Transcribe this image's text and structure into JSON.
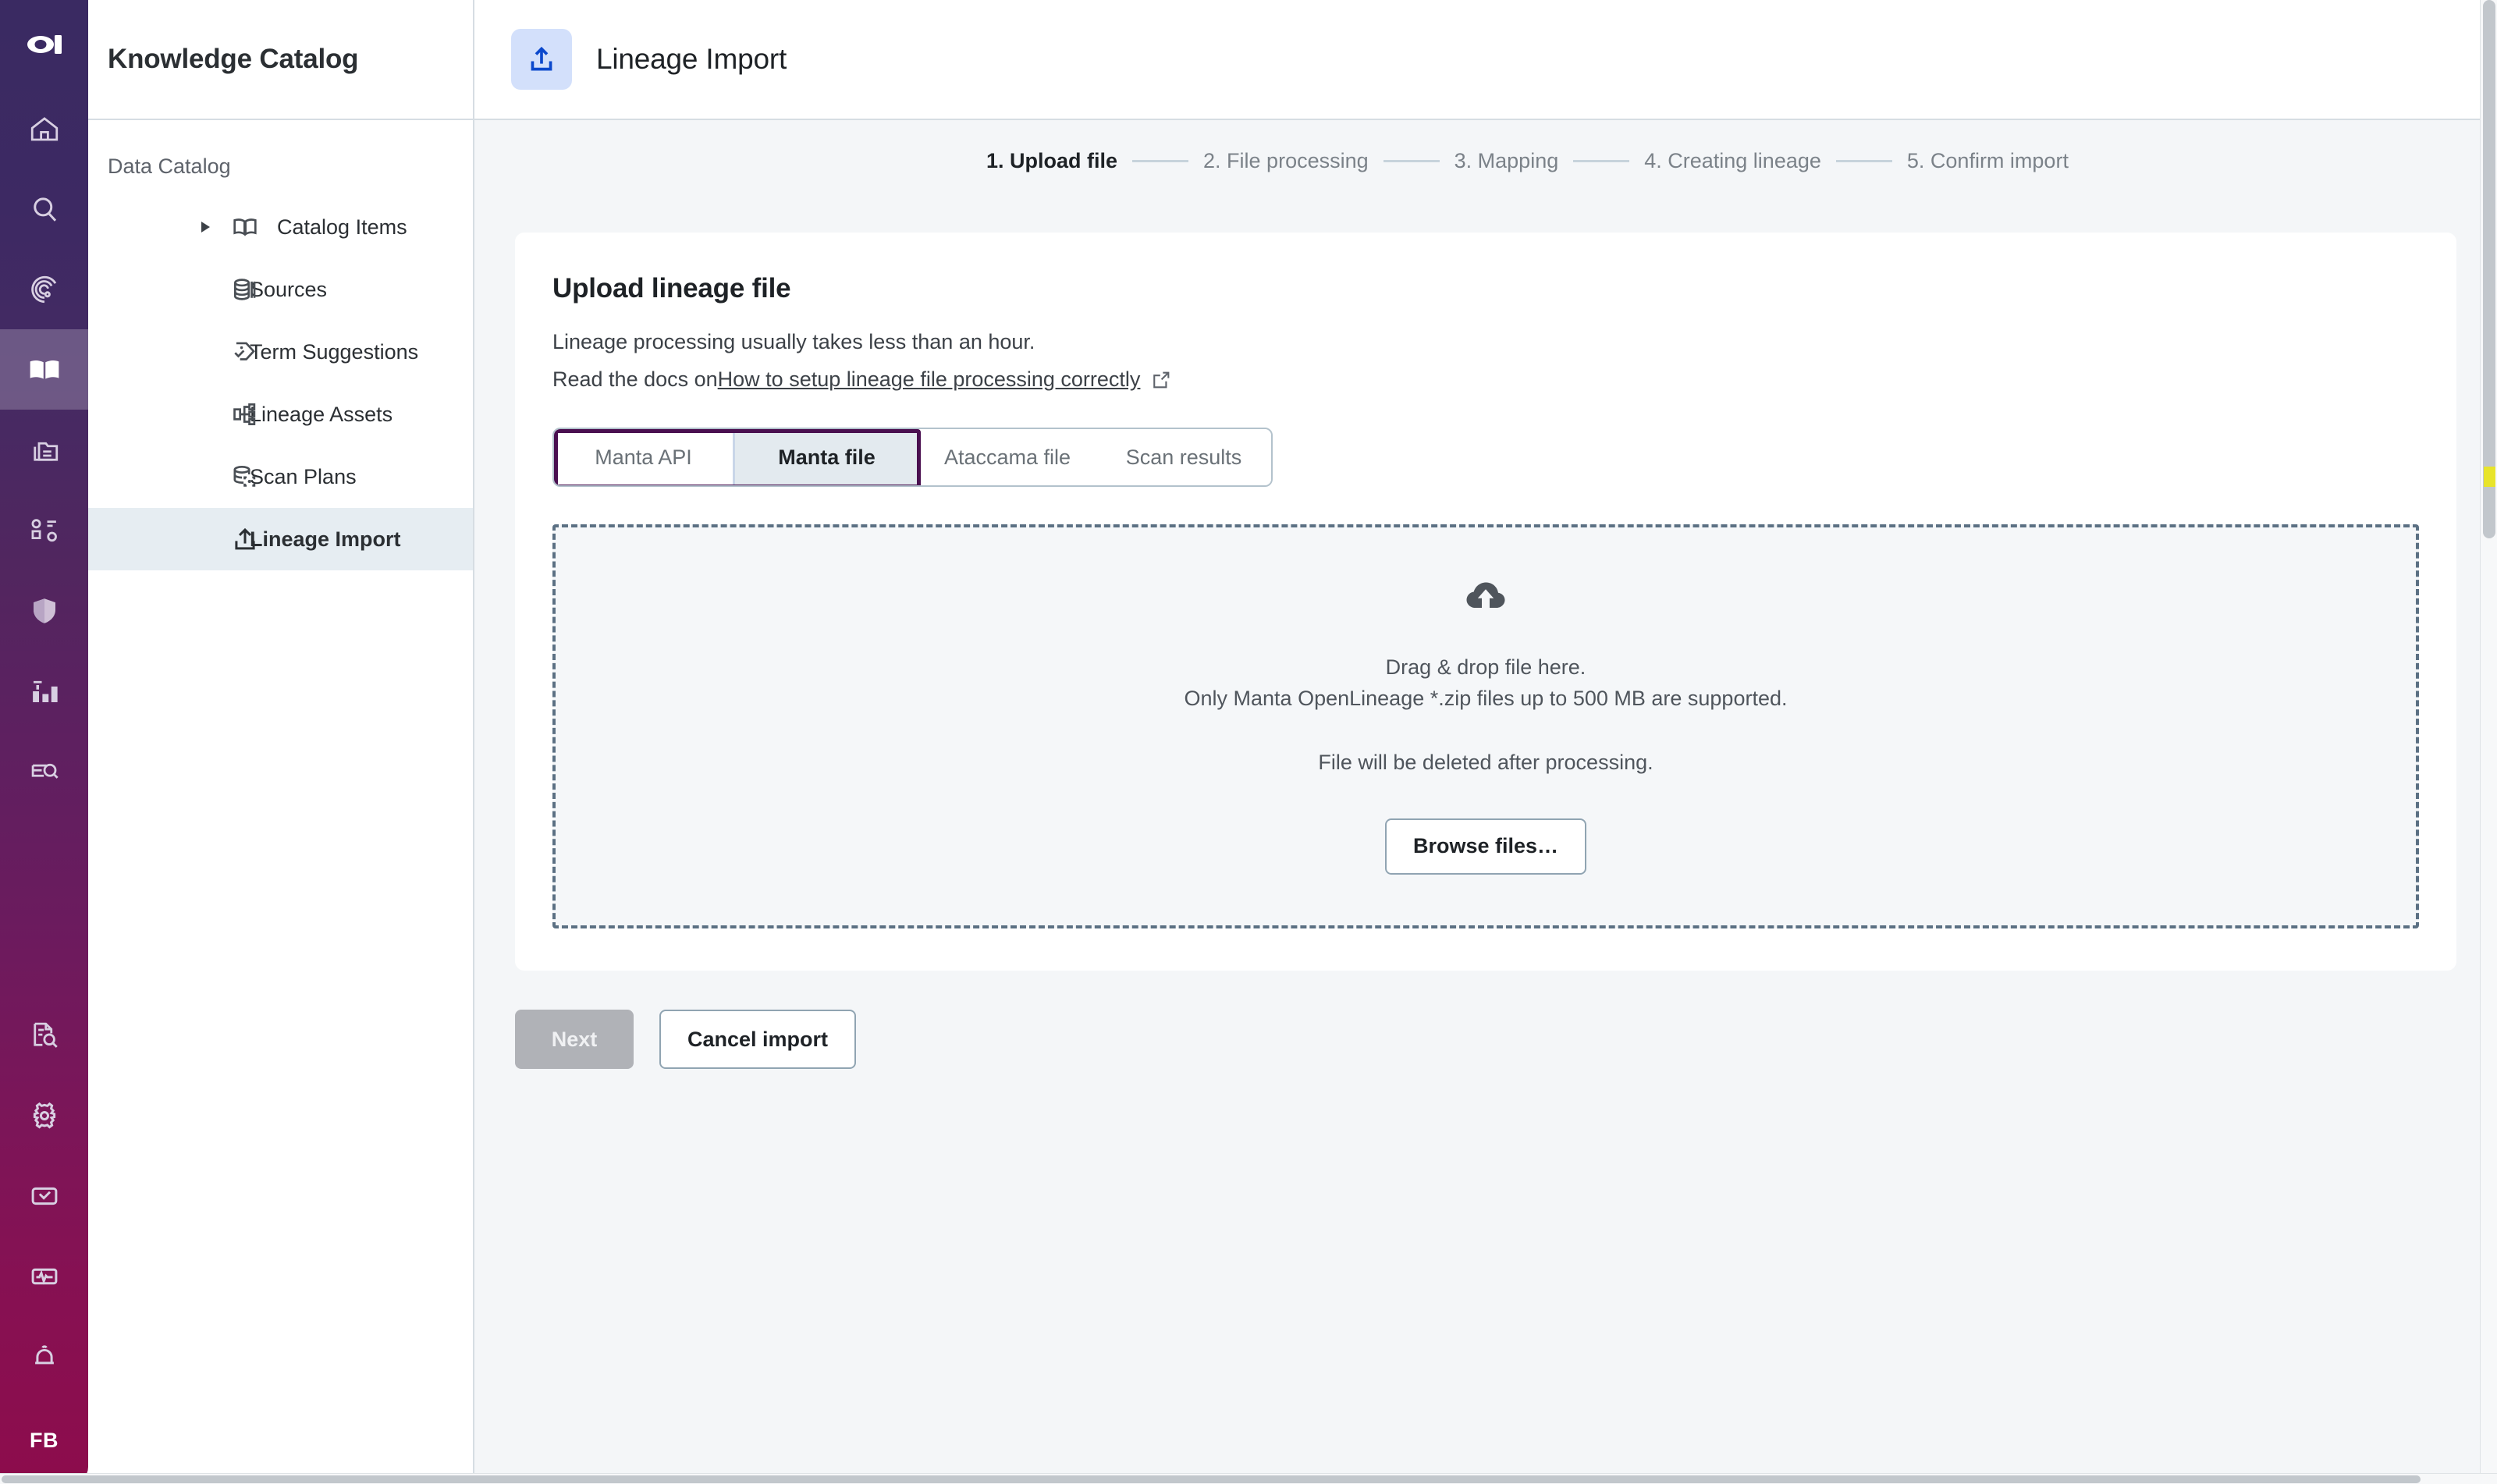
{
  "rail": {
    "logo_icon": "ataccama-logo-icon",
    "items": [
      {
        "icon": "home-icon",
        "name": "home",
        "active": false
      },
      {
        "icon": "search-icon",
        "name": "search",
        "active": false
      },
      {
        "icon": "radar-icon",
        "name": "data-observability",
        "active": false
      },
      {
        "icon": "book-icon",
        "name": "knowledge-catalog",
        "active": true
      },
      {
        "icon": "folders-icon",
        "name": "data-sources",
        "active": false
      },
      {
        "icon": "model-icon",
        "name": "data-model",
        "active": false
      },
      {
        "icon": "shield-icon",
        "name": "data-governance",
        "active": false
      },
      {
        "icon": "bar-chart-icon",
        "name": "data-quality",
        "active": false
      },
      {
        "icon": "document-search-icon",
        "name": "data-explorer",
        "active": false
      },
      {
        "icon": "file-search-icon",
        "name": "reports",
        "active": false
      },
      {
        "icon": "gear-icon",
        "name": "settings",
        "active": false
      },
      {
        "icon": "check-inbox-icon",
        "name": "tasks",
        "active": false
      },
      {
        "icon": "monitoring-icon",
        "name": "monitoring",
        "active": false
      },
      {
        "icon": "bell-icon",
        "name": "notifications",
        "active": false
      }
    ],
    "avatar_initials": "FB"
  },
  "sidebar": {
    "title": "Knowledge Catalog",
    "section_label": "Data Catalog",
    "items": [
      {
        "label": "Catalog Items",
        "icon": "book-open-icon",
        "caret": true,
        "selected": false
      },
      {
        "label": "Sources",
        "icon": "database-icon",
        "caret": false,
        "selected": false
      },
      {
        "label": "Term Suggestions",
        "icon": "tag-check-icon",
        "caret": false,
        "selected": false
      },
      {
        "label": "Lineage Assets",
        "icon": "lineage-nodes-icon",
        "caret": false,
        "selected": false
      },
      {
        "label": "Scan Plans",
        "icon": "scan-database-icon",
        "caret": false,
        "selected": false
      },
      {
        "label": "Lineage Import",
        "icon": "upload-icon",
        "caret": false,
        "selected": true
      }
    ]
  },
  "header": {
    "icon": "upload-icon",
    "title": "Lineage Import",
    "icon_bg": "#d3e0fb",
    "icon_color": "#0b48cc"
  },
  "stepper": {
    "steps": [
      {
        "label": "1. Upload file",
        "current": true
      },
      {
        "label": "2. File processing",
        "current": false
      },
      {
        "label": "3. Mapping",
        "current": false
      },
      {
        "label": "4. Creating lineage",
        "current": false
      },
      {
        "label": "5. Confirm import",
        "current": false
      }
    ]
  },
  "card": {
    "title": "Upload lineage file",
    "desc_line1": "Lineage processing usually takes less than an hour.",
    "desc_line2_prefix": "Read the docs on ",
    "desc_link": "How to setup lineage file processing correctly",
    "external_link_icon": "external-link-icon",
    "tabs": [
      {
        "label": "Manta API",
        "selected": false,
        "focused": true
      },
      {
        "label": "Manta file",
        "selected": true,
        "focused": true
      },
      {
        "label": "Ataccama file",
        "selected": false,
        "focused": false
      },
      {
        "label": "Scan results",
        "selected": false,
        "focused": false
      }
    ],
    "dropzone": {
      "icon": "cloud-upload-icon",
      "line1": "Drag & drop file here.",
      "line2": "Only Manta OpenLineage *.zip files up to 500 MB are supported.",
      "note": "File will be deleted after processing.",
      "browse_label": "Browse files…"
    }
  },
  "actions": {
    "next_label": "Next",
    "cancel_label": "Cancel import"
  },
  "colors": {
    "rail_top": "#3a2a62",
    "rail_bottom": "#8d0c4c",
    "focus_ring": "#4a1050",
    "accent_blue": "#0b48cc",
    "selected_nav_bg": "#e6edf2",
    "page_bg": "#f4f6f8",
    "dashed_border": "#5b7083",
    "find_highlight": "#e8e42a"
  }
}
